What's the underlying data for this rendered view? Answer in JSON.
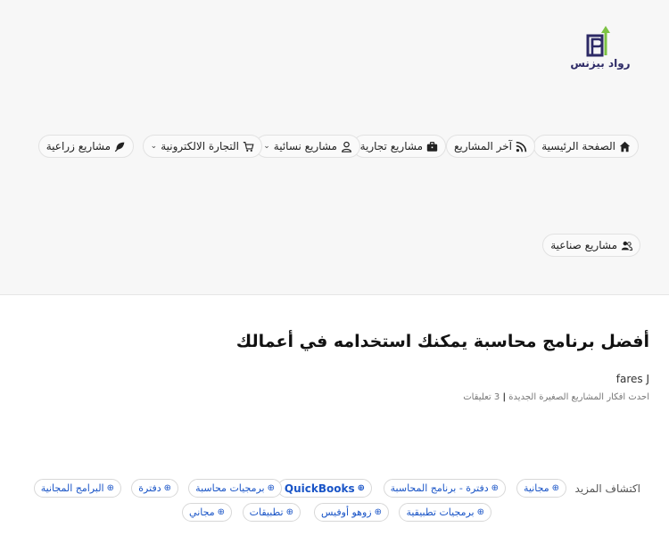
{
  "logo": {
    "text": "رواد بيزنس",
    "colors": {
      "primary": "#2d2a66",
      "accent": "#7cc243"
    }
  },
  "nav": [
    {
      "label": "الصفحة الرئيسية",
      "icon": "home-icon"
    },
    {
      "label": "آخر المشاريع",
      "icon": "rss-icon"
    },
    {
      "label": "مشاريع تجارية",
      "icon": "briefcase-icon"
    },
    {
      "label": "مشاريع نسائية",
      "icon": "user-icon",
      "dropdown": true
    },
    {
      "label": "التجارة الالكترونية",
      "icon": "cart-icon",
      "dropdown": true
    },
    {
      "label": "مشاريع زراعية",
      "icon": "leaf-icon"
    },
    {
      "label": "مشاريع صناعية",
      "icon": "users-icon"
    }
  ],
  "article": {
    "title": "أفضل برنامج محاسبة يمكنك استخدامه في أعمالك",
    "author": "fares J",
    "category": "احدث افكار المشاريع الصغيرة الجديدة",
    "separator": "|",
    "comments": "3 تعليقات"
  },
  "explore": {
    "label": "اكتشاف المزيد",
    "tags": [
      "مجانية",
      "دفترة - برنامج المحاسبة",
      "QuickBooks",
      "برمجيات محاسبة",
      "دفترة",
      "البرامج المجانية",
      "برمجيات تطبيقية",
      "زوهو أوفيس",
      "تطبيقات",
      "مجاني"
    ]
  },
  "colors": {
    "link": "#1a55c7",
    "header_bg": "#f7f7f7"
  }
}
